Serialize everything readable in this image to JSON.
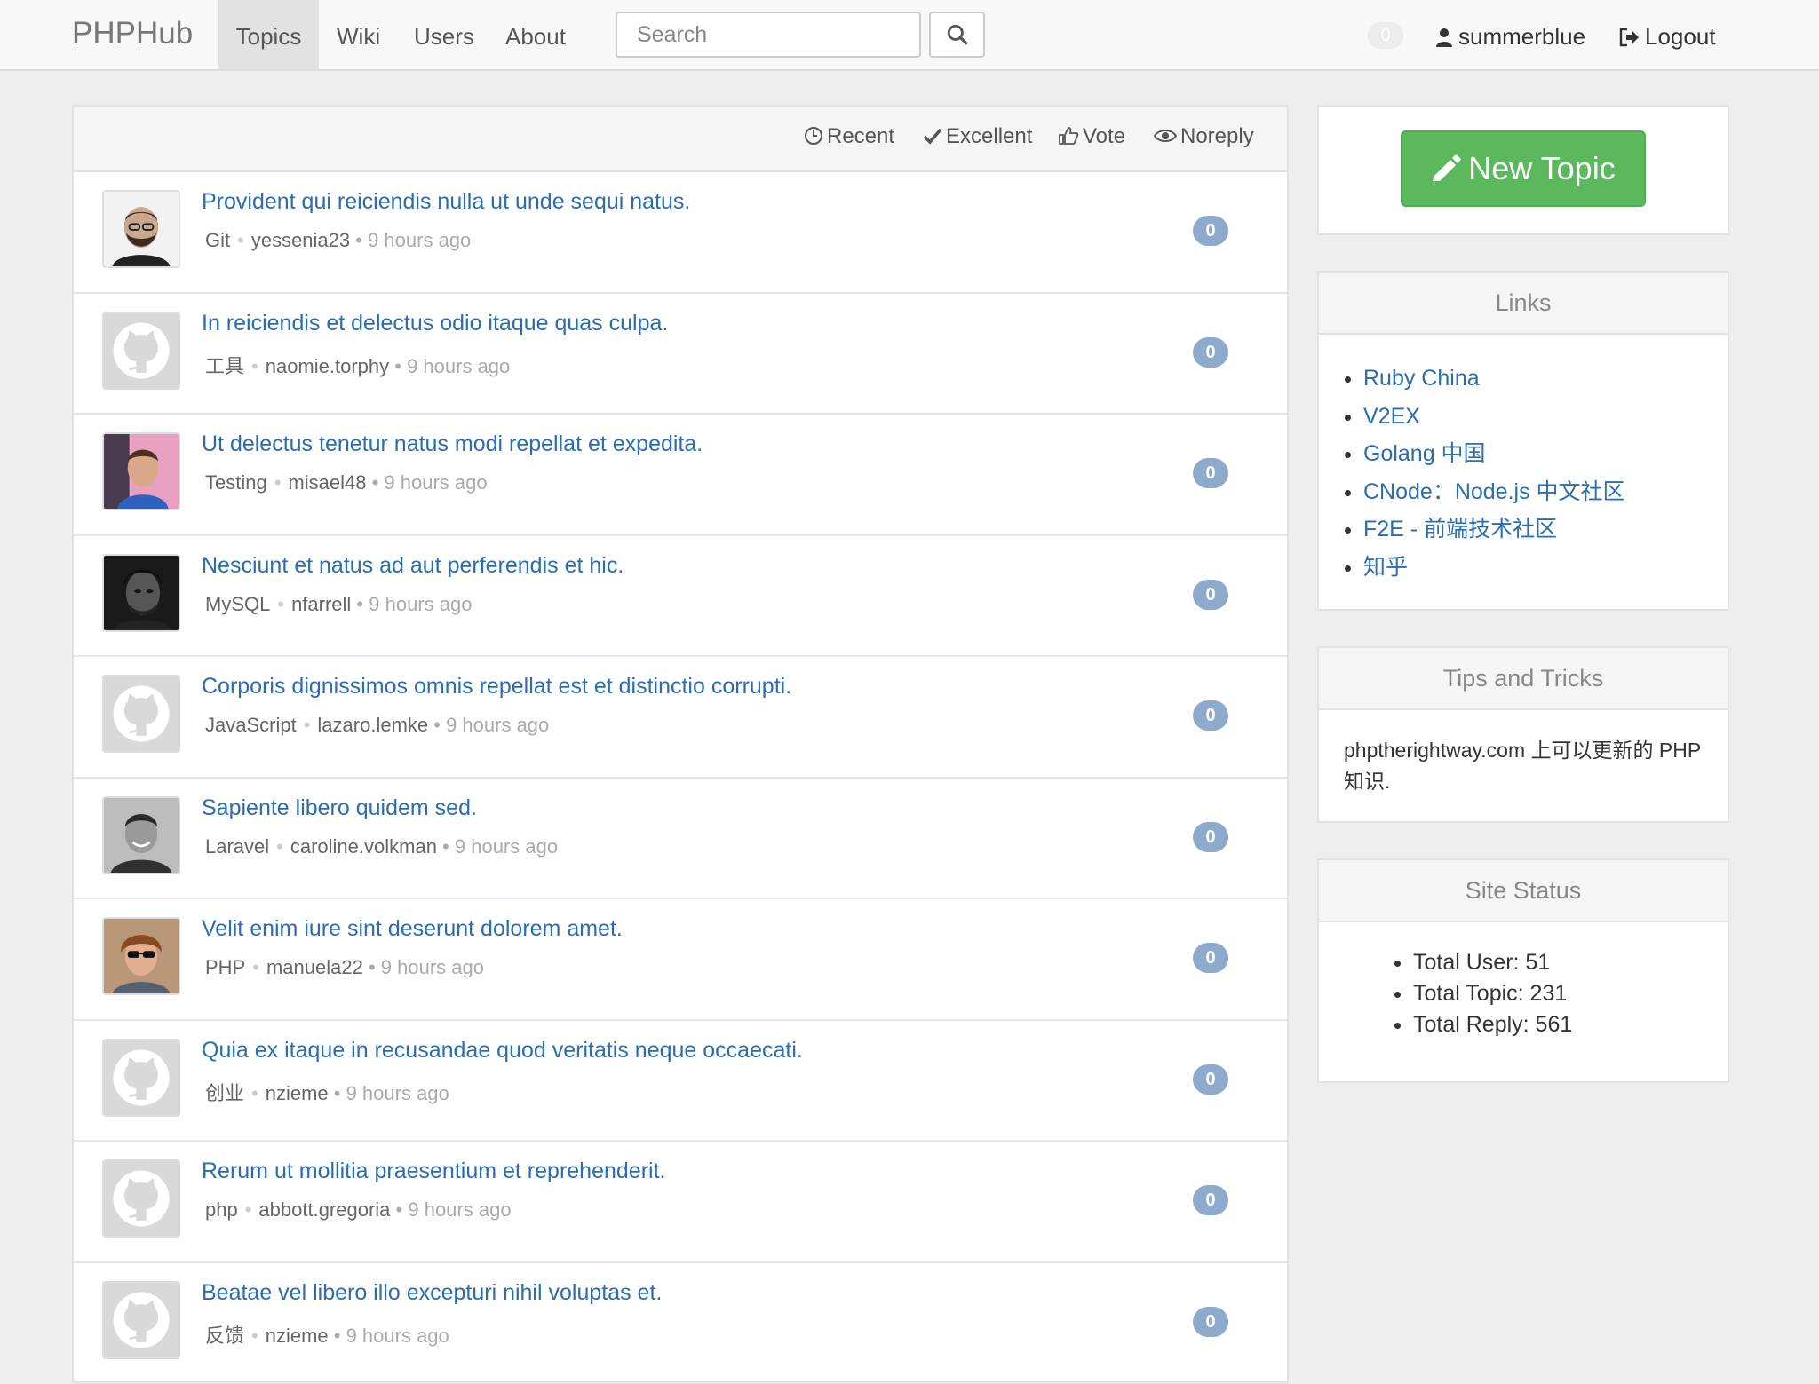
{
  "nav": {
    "brand": "PHPHub",
    "items": [
      "Topics",
      "Wiki",
      "Users",
      "About"
    ],
    "search_placeholder": "Search",
    "notification_count": "0",
    "username": "summerblue",
    "logout": "Logout"
  },
  "filters": [
    "Recent",
    "Excellent",
    "Vote",
    "Noreply"
  ],
  "topics": [
    {
      "title": "Provident qui reiciendis nulla ut unde sequi natus.",
      "node": "Git",
      "author": "yessenia23",
      "time": "9 hours ago",
      "replies": "0",
      "avatar": "photo-bearded-man"
    },
    {
      "title": "In reiciendis et delectus odio itaque quas culpa.",
      "node": "工具",
      "author": "naomie.torphy",
      "time": "9 hours ago",
      "replies": "0",
      "avatar": "github-octocat"
    },
    {
      "title": "Ut delectus tenetur natus modi repellat et expedita.",
      "node": "Testing",
      "author": "misael48",
      "time": "9 hours ago",
      "replies": "0",
      "avatar": "photo-man-blue"
    },
    {
      "title": "Nesciunt et natus ad aut perferendis et hic.",
      "node": "MySQL",
      "author": "nfarrell",
      "time": "9 hours ago",
      "replies": "0",
      "avatar": "photo-dark-portrait"
    },
    {
      "title": "Corporis dignissimos omnis repellat est et distinctio corrupti.",
      "node": "JavaScript",
      "author": "lazaro.lemke",
      "time": "9 hours ago",
      "replies": "0",
      "avatar": "github-octocat"
    },
    {
      "title": "Sapiente libero quidem sed.",
      "node": "Laravel",
      "author": "caroline.volkman",
      "time": "9 hours ago",
      "replies": "0",
      "avatar": "photo-smiling-man"
    },
    {
      "title": "Velit enim iure sint deserunt dolorem amet.",
      "node": "PHP",
      "author": "manuela22",
      "time": "9 hours ago",
      "replies": "0",
      "avatar": "photo-sunglasses"
    },
    {
      "title": "Quia ex itaque in recusandae quod veritatis neque occaecati.",
      "node": "创业",
      "author": "nzieme",
      "time": "9 hours ago",
      "replies": "0",
      "avatar": "github-octocat"
    },
    {
      "title": "Rerum ut mollitia praesentium et reprehenderit.",
      "node": "php",
      "author": "abbott.gregoria",
      "time": "9 hours ago",
      "replies": "0",
      "avatar": "github-octocat"
    },
    {
      "title": "Beatae vel libero illo excepturi nihil voluptas et.",
      "node": "反馈",
      "author": "nzieme",
      "time": "9 hours ago",
      "replies": "0",
      "avatar": "github-octocat"
    }
  ],
  "sidebar": {
    "new_topic": "New Topic",
    "links_title": "Links",
    "links": [
      "Ruby China",
      "V2EX",
      "Golang 中国",
      "CNode：Node.js 中文社区",
      "F2E - 前端技术社区",
      "知乎"
    ],
    "tips_title": "Tips and Tricks",
    "tips_text": "phptherightway.com 上可以更新的 PHP 知识.",
    "status_title": "Site Status",
    "status": [
      "Total User: 51",
      "Total Topic: 231",
      "Total Reply: 561"
    ]
  },
  "colors": {
    "link": "#2a6db0",
    "success": "#5cb85c",
    "badge": "#8da9cb"
  }
}
